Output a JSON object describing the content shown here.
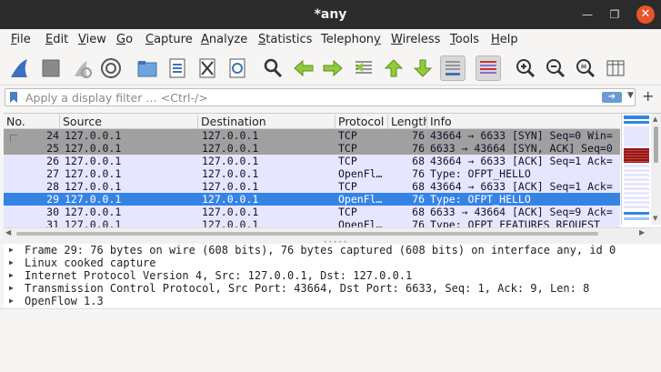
{
  "window": {
    "title": "*any"
  },
  "menu": [
    {
      "label": "File",
      "u": "F",
      "rest": "ile"
    },
    {
      "label": "Edit",
      "u": "E",
      "rest": "dit"
    },
    {
      "label": "View",
      "u": "V",
      "rest": "iew"
    },
    {
      "label": "Go",
      "u": "G",
      "rest": "o"
    },
    {
      "label": "Capture",
      "u": "C",
      "rest": "apture"
    },
    {
      "label": "Analyze",
      "u": "A",
      "rest": "nalyze"
    },
    {
      "label": "Statistics",
      "u": "S",
      "rest": "tatistics"
    },
    {
      "label": "Telephony",
      "u": "y",
      "rest": "Telephon"
    },
    {
      "label": "Wireless",
      "u": "W",
      "rest": "ireless"
    },
    {
      "label": "Tools",
      "u": "T",
      "rest": "ools"
    },
    {
      "label": "Help",
      "u": "H",
      "rest": "elp"
    }
  ],
  "toolbar_icons": [
    "shark-fin-start-icon",
    "stop-capture-icon",
    "restart-capture-icon",
    "capture-options-gear-icon",
    "open-folder-icon",
    "save-file-icon",
    "close-file-icon",
    "reload-file-icon",
    "find-packet-icon",
    "go-back-icon",
    "go-forward-icon",
    "go-to-packet-icon",
    "go-first-icon",
    "go-last-icon",
    "autoscroll-icon",
    "colorize-icon",
    "zoom-in-icon",
    "zoom-out-icon",
    "zoom-normal-icon",
    "resize-columns-icon"
  ],
  "filter": {
    "placeholder": "Apply a display filter … <Ctrl-/>"
  },
  "columns": {
    "no": "No.",
    "source": "Source",
    "destination": "Destination",
    "protocol": "Protocol",
    "length": "Length",
    "info": "Info"
  },
  "packets": [
    {
      "no": "24",
      "source": "127.0.0.1",
      "destination": "127.0.0.1",
      "protocol": "TCP",
      "length": "76",
      "info": "43664 → 6633 [SYN] Seq=0 Win=",
      "style": "gray"
    },
    {
      "no": "25",
      "source": "127.0.0.1",
      "destination": "127.0.0.1",
      "protocol": "TCP",
      "length": "76",
      "info": "6633 → 43664 [SYN, ACK] Seq=0",
      "style": "gray"
    },
    {
      "no": "26",
      "source": "127.0.0.1",
      "destination": "127.0.0.1",
      "protocol": "TCP",
      "length": "68",
      "info": "43664 → 6633 [ACK] Seq=1 Ack=",
      "style": "lavender"
    },
    {
      "no": "27",
      "source": "127.0.0.1",
      "destination": "127.0.0.1",
      "protocol": "OpenFl…",
      "length": "76",
      "info": "Type: OFPT_HELLO",
      "style": "lavender"
    },
    {
      "no": "28",
      "source": "127.0.0.1",
      "destination": "127.0.0.1",
      "protocol": "TCP",
      "length": "68",
      "info": "43664 → 6633 [ACK] Seq=1 Ack=",
      "style": "lavender"
    },
    {
      "no": "29",
      "source": "127.0.0.1",
      "destination": "127.0.0.1",
      "protocol": "OpenFl…",
      "length": "76",
      "info": "Type: OFPT_HELLO",
      "style": "selected"
    },
    {
      "no": "30",
      "source": "127.0.0.1",
      "destination": "127.0.0.1",
      "protocol": "TCP",
      "length": "68",
      "info": "6633 → 43664 [ACK] Seq=9 Ack=",
      "style": "lavender"
    },
    {
      "no": "31",
      "source": "127.0.0.1",
      "destination": "127.0.0.1",
      "protocol": "OpenFl…",
      "length": "76",
      "info": "Type: OFPT_FEATURES_REQUEST",
      "style": "lavender"
    }
  ],
  "row_colors": {
    "gray": "#a0a0a0",
    "lavender": "#e7e6ff",
    "selected": "#3584e4",
    "selected_text": "#ffffff",
    "text": "#12122a"
  },
  "details": [
    "Frame 29: 76 bytes on wire (608 bits), 76 bytes captured (608 bits) on interface any, id 0",
    "Linux cooked capture",
    "Internet Protocol Version 4, Src: 127.0.0.1, Dst: 127.0.0.1",
    "Transmission Control Protocol, Src Port: 43664, Dst Port: 6633, Seq: 1, Ack: 9, Len: 8",
    "OpenFlow 1.3"
  ]
}
